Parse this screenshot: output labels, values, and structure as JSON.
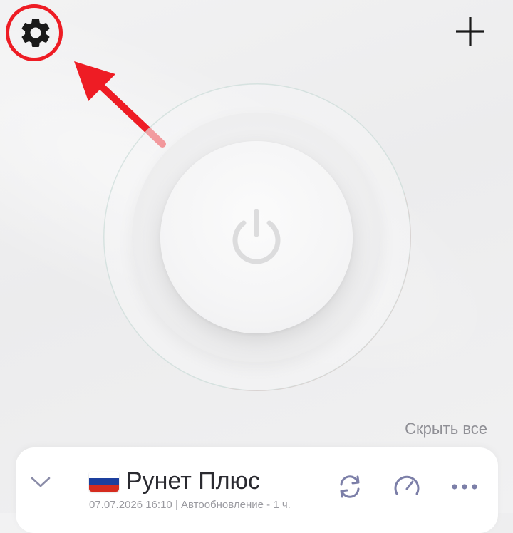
{
  "colors": {
    "accent_icon": "#7c7fa8",
    "annotation_red": "#ee1c24",
    "text_dark": "#2a2a30",
    "text_muted": "#8f8f95"
  },
  "toolbar": {
    "settings_icon": "gear-icon",
    "add_icon": "plus-icon"
  },
  "main": {
    "power_icon": "power-icon",
    "hide_all_label": "Скрыть все"
  },
  "server_card": {
    "flag": "russia-flag",
    "name": "Рунет Плюс",
    "updated_at": "07.07.2026 16:10",
    "separator": "|",
    "auto_update": "Автообновление - 1 ч.",
    "actions": [
      "refresh-icon",
      "speedometer-icon",
      "more-dots-icon"
    ]
  }
}
